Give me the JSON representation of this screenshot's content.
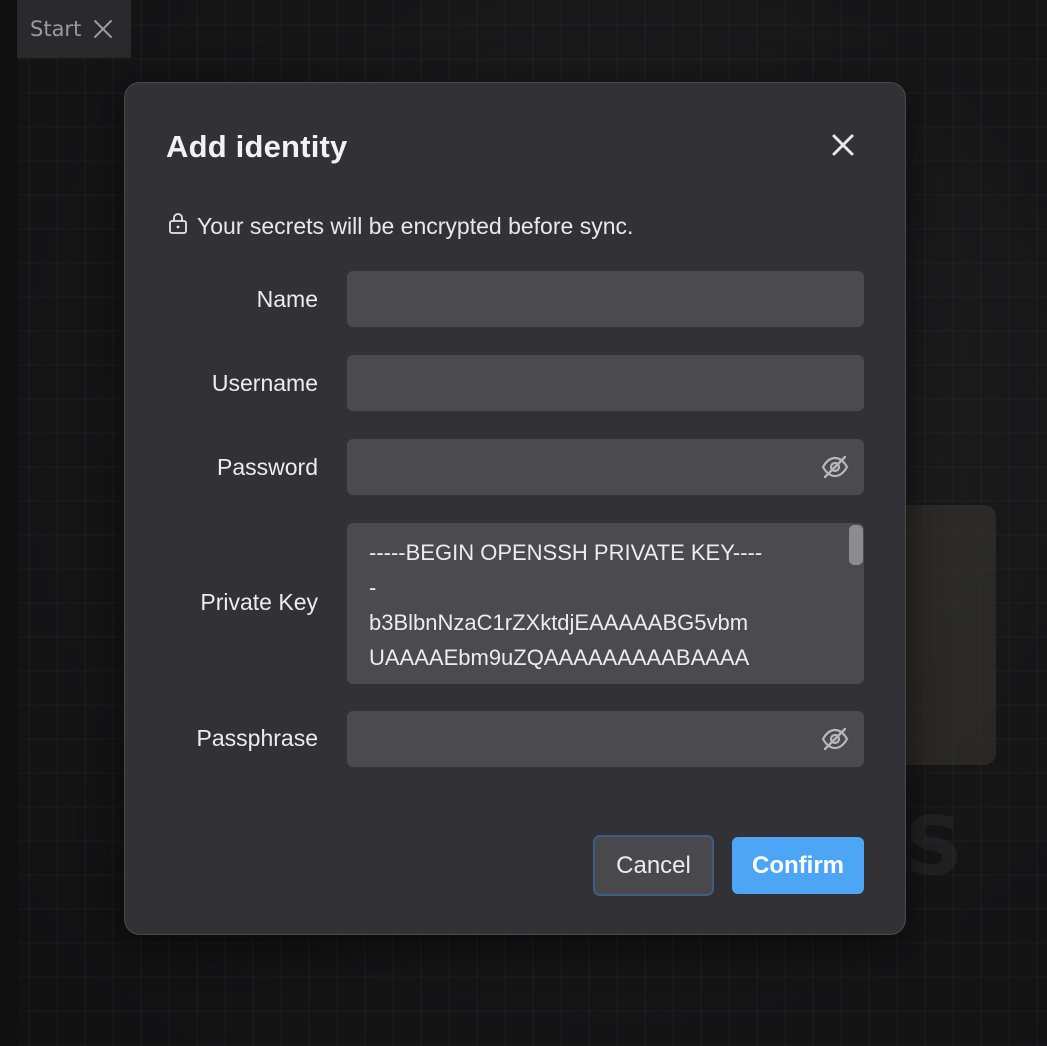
{
  "background": {
    "tab": {
      "label": "Start",
      "close_icon": "close-icon"
    }
  },
  "dialog": {
    "title": "Add identity",
    "close_icon": "close-icon",
    "notice": {
      "icon": "lock-icon",
      "text": "Your secrets will be encrypted before sync."
    },
    "fields": {
      "name": {
        "label": "Name",
        "value": ""
      },
      "username": {
        "label": "Username",
        "value": ""
      },
      "password": {
        "label": "Password",
        "value": "",
        "toggle_icon": "eye-off-icon"
      },
      "private_key": {
        "label": "Private Key",
        "lines": [
          "-----BEGIN OPENSSH PRIVATE KEY----",
          "-",
          "b3BlbnNzaC1rZXktdjEAAAAABG5vbm",
          "UAAAAEbm9uZQAAAAAAAAABAAAA"
        ]
      },
      "passphrase": {
        "label": "Passphrase",
        "value": "",
        "toggle_icon": "eye-off-icon"
      }
    },
    "buttons": {
      "cancel": "Cancel",
      "confirm": "Confirm"
    }
  },
  "colors": {
    "accent": "#4da6f5",
    "dialog_bg": "#323236",
    "input_bg": "#4a4a4f",
    "focus_ring": "#3d5d85"
  }
}
